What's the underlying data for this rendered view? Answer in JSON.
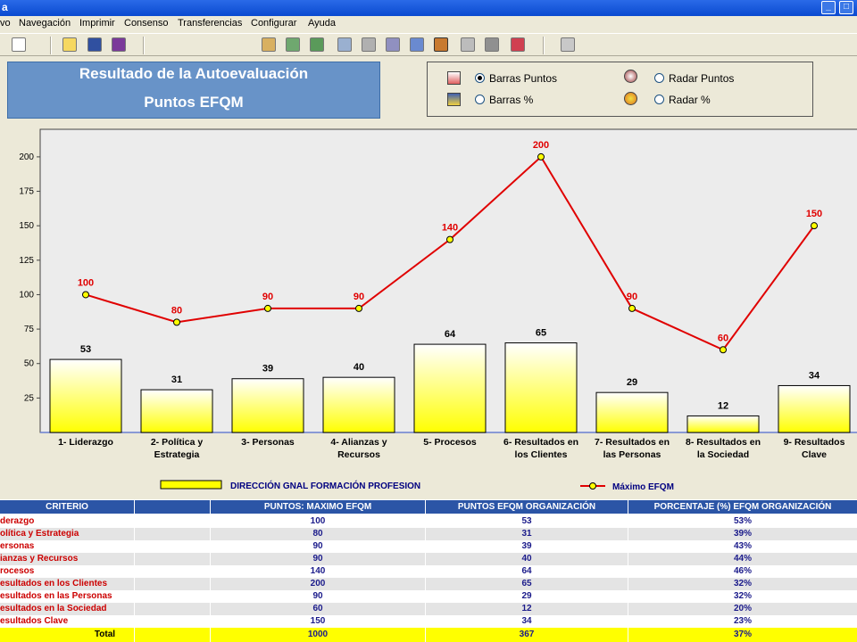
{
  "window": {
    "title": "a"
  },
  "menu": [
    "vo",
    "Navegación",
    "Imprimir",
    "Consenso",
    "Transferencias",
    "Configurar",
    "Ayuda"
  ],
  "header": {
    "line1": "Resultado de la Autoevaluación",
    "line2": "Puntos EFQM"
  },
  "options": [
    {
      "label": "Barras Puntos",
      "selected": true
    },
    {
      "label": "Barras %",
      "selected": false
    },
    {
      "label": "Radar Puntos",
      "selected": false
    },
    {
      "label": "Radar %",
      "selected": false
    }
  ],
  "chart_data": {
    "type": "bar",
    "categories": [
      "1- Liderazgo",
      "2- Política y Estrategia",
      "3- Personas",
      "4- Alianzas y Recursos",
      "5- Procesos",
      "6- Resultados en los Clientes",
      "7- Resultados en las Personas",
      "8- Resultados en la Sociedad",
      "9- Resultados Clave"
    ],
    "category_lines": [
      [
        "1- Liderazgo"
      ],
      [
        "2- Política y",
        "Estrategia"
      ],
      [
        "3- Personas"
      ],
      [
        "4- Alianzas y",
        "Recursos"
      ],
      [
        "5- Procesos"
      ],
      [
        "6- Resultados en",
        "los Clientes"
      ],
      [
        "7- Resultados en",
        "las Personas"
      ],
      [
        "8- Resultados en",
        "la Sociedad"
      ],
      [
        "9- Resultados",
        "Clave"
      ]
    ],
    "series": [
      {
        "name": "DIRECCIÓN GNAL FORMACIÓN PROFESION",
        "type": "bar",
        "values": [
          53,
          31,
          39,
          40,
          64,
          65,
          29,
          12,
          34
        ]
      },
      {
        "name": "Máximo EFQM",
        "type": "line",
        "values": [
          100,
          80,
          90,
          90,
          140,
          200,
          90,
          60,
          150
        ]
      }
    ],
    "yticks": [
      25,
      50,
      75,
      100,
      125,
      150,
      175,
      200
    ],
    "ylim": [
      0,
      220
    ],
    "colors": {
      "bar_top": "#ffffff",
      "bar_bottom": "#ffff00",
      "line": "#e00000",
      "marker": "#ffff00",
      "line_label": "#e00000"
    },
    "legend": "bottom"
  },
  "table": {
    "headers": [
      "CRITERIO",
      "",
      "PUNTOS: MAXIMO EFQM",
      "PUNTOS EFQM ORGANIZACIÓN",
      "PORCENTAJE (%) EFQM ORGANIZACIÓN"
    ],
    "rows": [
      [
        "derazgo",
        "100",
        "53",
        "53%"
      ],
      [
        "olítica y Estrategia",
        "80",
        "31",
        "39%"
      ],
      [
        "ersonas",
        "90",
        "39",
        "43%"
      ],
      [
        "ianzas y Recursos",
        "90",
        "40",
        "44%"
      ],
      [
        "rocesos",
        "140",
        "64",
        "46%"
      ],
      [
        "esultados en los Clientes",
        "200",
        "65",
        "32%"
      ],
      [
        "esultados en las Personas",
        "90",
        "29",
        "32%"
      ],
      [
        "esultados en la Sociedad",
        "60",
        "12",
        "20%"
      ],
      [
        "esultados Clave",
        "150",
        "34",
        "23%"
      ]
    ],
    "total": [
      "Total",
      "1000",
      "367",
      "37%"
    ],
    "colors": {
      "header_bg": "#2b55a6",
      "header_fg": "#ffffff",
      "crit_fg": "#cc0000",
      "num_fg": "#1a1a8a",
      "row_alt": "#e4e4e4",
      "total_bg": "#ffff00"
    }
  }
}
